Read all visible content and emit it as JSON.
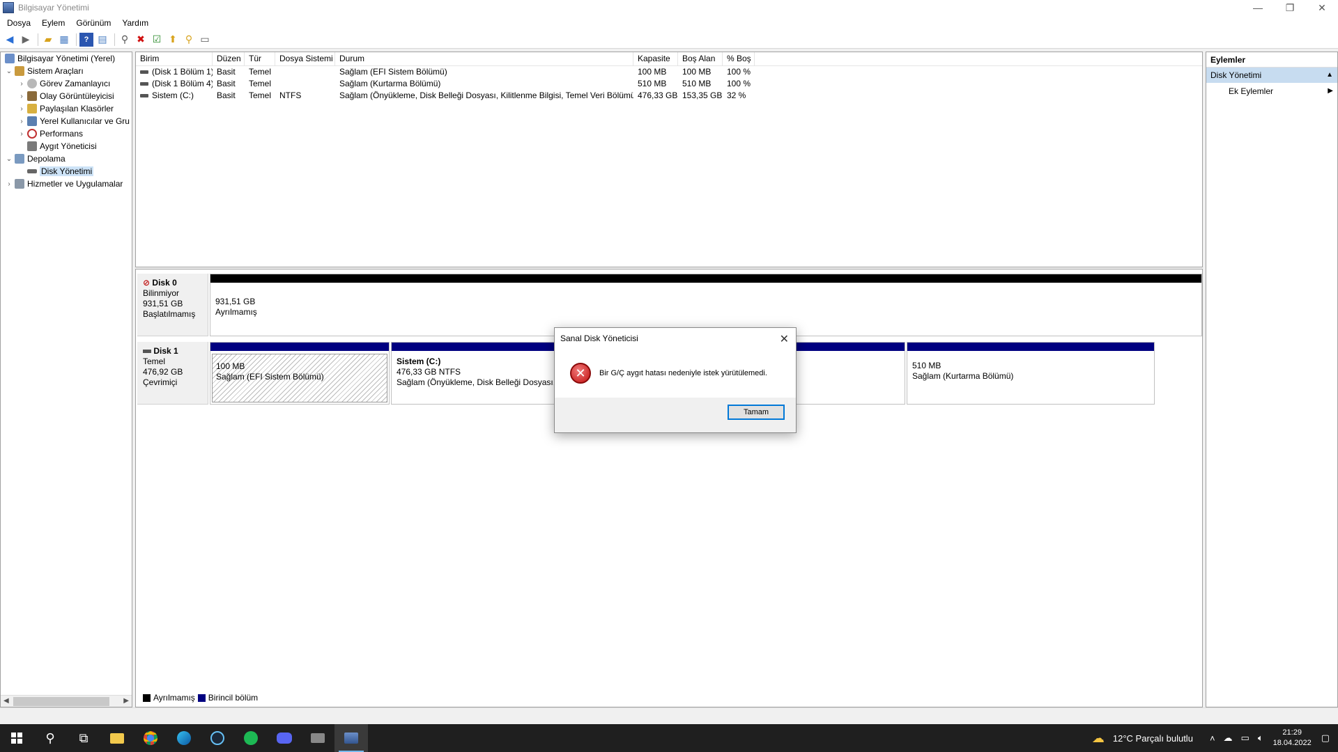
{
  "window": {
    "title": "Bilgisayar Yönetimi",
    "controls": {
      "minimize": "—",
      "restore": "❐",
      "close": "✕"
    }
  },
  "menu": [
    "Dosya",
    "Eylem",
    "Görünüm",
    "Yardım"
  ],
  "tree": {
    "root": "Bilgisayar Yönetimi (Yerel)",
    "items": [
      {
        "label": "Sistem Araçları",
        "level": 1
      },
      {
        "label": "Görev Zamanlayıcı",
        "level": 2
      },
      {
        "label": "Olay Görüntüleyicisi",
        "level": 2
      },
      {
        "label": "Paylaşılan Klasörler",
        "level": 2
      },
      {
        "label": "Yerel Kullanıcılar ve Gru",
        "level": 2
      },
      {
        "label": "Performans",
        "level": 2
      },
      {
        "label": "Aygıt Yöneticisi",
        "level": 2
      },
      {
        "label": "Depolama",
        "level": 1
      },
      {
        "label": "Disk Yönetimi",
        "level": 2
      },
      {
        "label": "Hizmetler ve Uygulamalar",
        "level": 1
      }
    ]
  },
  "volume_table": {
    "columns": [
      "Birim",
      "Düzen",
      "Tür",
      "Dosya Sistemi",
      "Durum",
      "Kapasite",
      "Boş Alan",
      "% Boş"
    ],
    "rows": [
      [
        "(Disk 1 Bölüm 1)",
        "Basit",
        "Temel",
        "",
        "Sağlam (EFI Sistem Bölümü)",
        "100 MB",
        "100 MB",
        "100 %"
      ],
      [
        "(Disk 1 Bölüm 4)",
        "Basit",
        "Temel",
        "",
        "Sağlam (Kurtarma Bölümü)",
        "510 MB",
        "510 MB",
        "100 %"
      ],
      [
        "Sistem (C:)",
        "Basit",
        "Temel",
        "NTFS",
        "Sağlam (Önyükleme, Disk Belleği Dosyası, Kilitlenme Bilgisi, Temel Veri Bölümü)",
        "476,33 GB",
        "153,35 GB",
        "32 %"
      ]
    ]
  },
  "disks": {
    "disk0": {
      "name": "Disk 0",
      "type": "Bilinmiyor",
      "size": "931,51 GB",
      "status": "Başlatılmamış",
      "part_size": "931,51 GB",
      "part_status": "Ayrılmamış"
    },
    "disk1": {
      "name": "Disk 1",
      "type": "Temel",
      "size": "476,92 GB",
      "status": "Çevrimiçi",
      "p1_size": "100 MB",
      "p1_status": "Sağlam (EFI Sistem Bölümü)",
      "p2_name": "Sistem  (C:)",
      "p2_size": "476,33 GB NTFS",
      "p2_status": "Sağlam (Önyükleme, Disk Belleği Dosyası, K",
      "p3_size": "510 MB",
      "p3_status": "Sağlam (Kurtarma Bölümü)"
    }
  },
  "legend": {
    "unallocated": "Ayrılmamış",
    "primary": "Birincil bölüm"
  },
  "actions": {
    "header": "Eylemler",
    "section": "Disk Yönetimi",
    "item": "Ek Eylemler"
  },
  "dialog": {
    "title": "Sanal Disk Yöneticisi",
    "message": "Bir G/Ç aygıt hatası nedeniyle istek yürütülemedi.",
    "ok": "Tamam"
  },
  "taskbar": {
    "weather": "12°C  Parçalı bulutlu",
    "time": "21:29",
    "date": "18.04.2022"
  },
  "colors": {
    "unallocated": "#000000",
    "primary": "#000080",
    "selection": "#cde3f7",
    "accent": "#0078d7"
  }
}
